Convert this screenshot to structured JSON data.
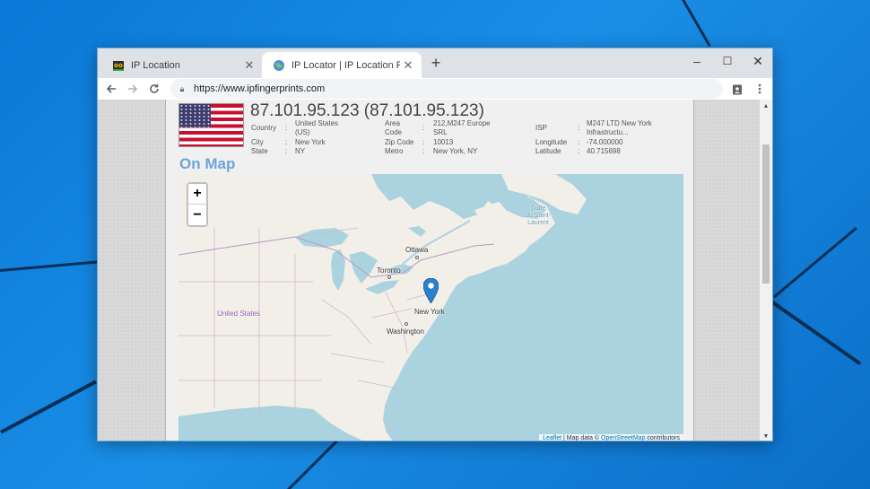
{
  "browser": {
    "tabs": [
      {
        "title": "IP Location",
        "icon": "owl-favicon-icon",
        "active": false
      },
      {
        "title": "IP Locator | IP Location Finder | L",
        "icon": "globe-favicon-icon",
        "active": true
      }
    ],
    "new_tab_label": "+",
    "url": "https://www.ipfingerprints.com",
    "window_controls": {
      "minimize": "–",
      "maximize": "☐",
      "close": "✕"
    }
  },
  "ip_info": {
    "heading": "87.101.95.123 (87.101.95.123)",
    "fields": {
      "country": {
        "label": "Country",
        "value": "United States (US)"
      },
      "city": {
        "label": "City",
        "value": "New York"
      },
      "state": {
        "label": "State",
        "value": "NY"
      },
      "area_code": {
        "label": "Area Code",
        "value": "212,M247 Europe SRL"
      },
      "zip_code": {
        "label": "Zip Code",
        "value": "10013"
      },
      "metro": {
        "label": "Metro",
        "value": "New York, NY"
      },
      "isp": {
        "label": "ISP",
        "value": "M247 LTD New York Infrastructu..."
      },
      "longitude": {
        "label": "Longitude",
        "value": "-74.000000"
      },
      "latitude": {
        "label": "Latitude",
        "value": "40.715698"
      }
    },
    "separator": ":"
  },
  "map": {
    "section_title": "On Map",
    "zoom_in": "+",
    "zoom_out": "−",
    "labels": {
      "ottawa": "Ottawa",
      "toronto": "Toronto",
      "new_york": "New York",
      "washington": "Washington",
      "united_states": "United States",
      "gulf_line1": "Golfe",
      "gulf_line2": "du Saint-",
      "gulf_line3": "Laurent"
    },
    "attribution": {
      "leaflet": "Leaflet",
      "middle": " | Map data © ",
      "osm": "OpenStreetMap",
      "end": " contributors"
    }
  },
  "colors": {
    "ocean": "#aad3df",
    "land": "#f2efe9",
    "heading_blue": "#6fa3d8",
    "marker": "#2a81cb"
  }
}
